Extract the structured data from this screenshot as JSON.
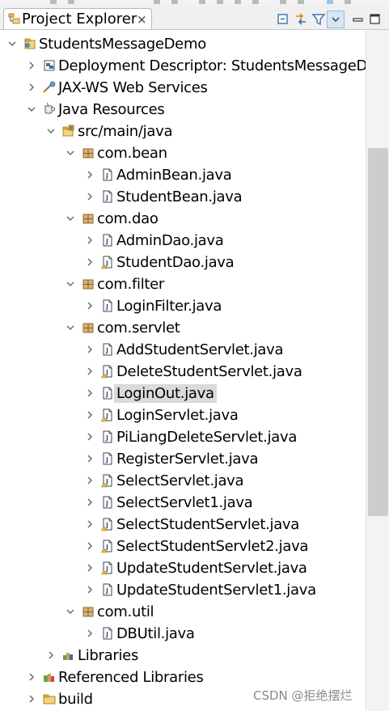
{
  "view": {
    "tab_title": "Project Explorer",
    "close_glyph": "×",
    "toolbar": [
      "collapse-all-icon",
      "link-with-editor-icon",
      "filter-icon",
      "view-menu-icon",
      "minimize-icon",
      "maximize-icon"
    ]
  },
  "tree": [
    {
      "label": "StudentsMessageDemo",
      "icon": "project-icon",
      "depth": 0,
      "expanded": true
    },
    {
      "label": "Deployment Descriptor: StudentsMessageD",
      "icon": "deployment-descriptor-icon",
      "depth": 1,
      "expanded": false
    },
    {
      "label": "JAX-WS Web Services",
      "icon": "web-services-icon",
      "depth": 1,
      "expanded": false
    },
    {
      "label": "Java Resources",
      "icon": "java-resources-icon",
      "depth": 1,
      "expanded": true
    },
    {
      "label": "src/main/java",
      "icon": "source-folder-icon",
      "depth": 2,
      "expanded": true
    },
    {
      "label": "com.bean",
      "icon": "package-icon",
      "depth": 3,
      "expanded": true
    },
    {
      "label": "AdminBean.java",
      "icon": "java-file-icon",
      "depth": 4,
      "expanded": false
    },
    {
      "label": "StudentBean.java",
      "icon": "java-file-icon",
      "depth": 4,
      "expanded": false
    },
    {
      "label": "com.dao",
      "icon": "package-icon",
      "depth": 3,
      "expanded": true
    },
    {
      "label": "AdminDao.java",
      "icon": "java-file-icon",
      "depth": 4,
      "expanded": false
    },
    {
      "label": "StudentDao.java",
      "icon": "java-file-warning-icon",
      "depth": 4,
      "expanded": false
    },
    {
      "label": "com.filter",
      "icon": "package-icon",
      "depth": 3,
      "expanded": true
    },
    {
      "label": "LoginFilter.java",
      "icon": "java-file-icon",
      "depth": 4,
      "expanded": false
    },
    {
      "label": "com.servlet",
      "icon": "package-icon",
      "depth": 3,
      "expanded": true
    },
    {
      "label": "AddStudentServlet.java",
      "icon": "java-file-icon",
      "depth": 4,
      "expanded": false
    },
    {
      "label": "DeleteStudentServlet.java",
      "icon": "java-file-warning-icon",
      "depth": 4,
      "expanded": false
    },
    {
      "label": "LoginOut.java",
      "icon": "java-file-icon",
      "depth": 4,
      "expanded": false,
      "selected": true
    },
    {
      "label": "LoginServlet.java",
      "icon": "java-file-warning-icon",
      "depth": 4,
      "expanded": false
    },
    {
      "label": "PiLiangDeleteServlet.java",
      "icon": "java-file-icon",
      "depth": 4,
      "expanded": false
    },
    {
      "label": "RegisterServlet.java",
      "icon": "java-file-icon",
      "depth": 4,
      "expanded": false
    },
    {
      "label": "SelectServlet.java",
      "icon": "java-file-warning-icon",
      "depth": 4,
      "expanded": false
    },
    {
      "label": "SelectServlet1.java",
      "icon": "java-file-icon",
      "depth": 4,
      "expanded": false
    },
    {
      "label": "SelectStudentServlet.java",
      "icon": "java-file-warning-icon",
      "depth": 4,
      "expanded": false
    },
    {
      "label": "SelectStudentServlet2.java",
      "icon": "java-file-warning-icon",
      "depth": 4,
      "expanded": false
    },
    {
      "label": "UpdateStudentServlet.java",
      "icon": "java-file-warning-icon",
      "depth": 4,
      "expanded": false
    },
    {
      "label": "UpdateStudentServlet1.java",
      "icon": "java-file-icon",
      "depth": 4,
      "expanded": false
    },
    {
      "label": "com.util",
      "icon": "package-icon",
      "depth": 3,
      "expanded": true
    },
    {
      "label": "DBUtil.java",
      "icon": "java-file-icon",
      "depth": 4,
      "expanded": false
    },
    {
      "label": "Libraries",
      "icon": "libraries-icon",
      "depth": 2,
      "expanded": false
    },
    {
      "label": "Referenced Libraries",
      "icon": "referenced-libraries-icon",
      "depth": 1,
      "expanded": false
    },
    {
      "label": "build",
      "icon": "folder-icon",
      "depth": 1,
      "expanded": false
    }
  ],
  "watermark": "CSDN @拒绝摆烂"
}
